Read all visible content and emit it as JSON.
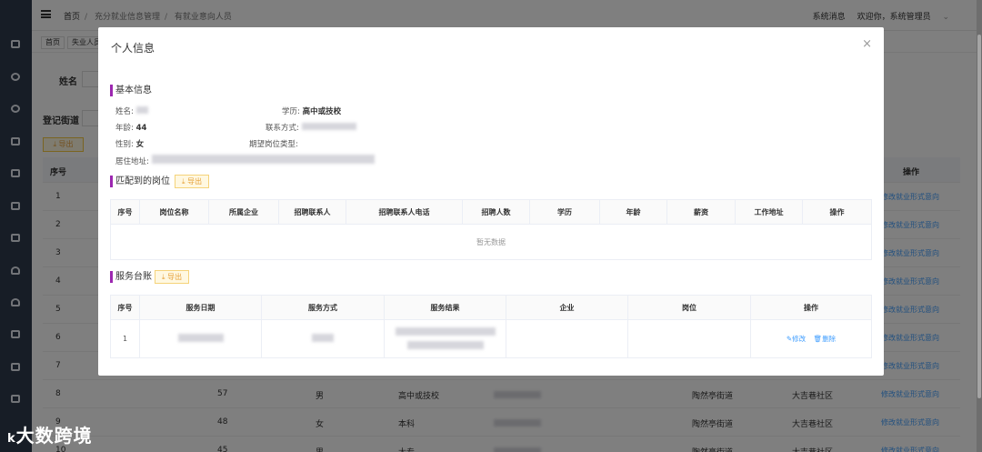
{
  "header": {
    "breadcrumbs": [
      "首页",
      "充分就业信息管理",
      "有就业意向人员"
    ],
    "notice": "系统消息",
    "user_greeting": "欢迎你，系统管理员"
  },
  "tabs": [
    "首页",
    "失业人员"
  ],
  "filters": {
    "name_label": "姓名",
    "street_label": "登记街道"
  },
  "page_export": "导出",
  "page_table": {
    "headers": [
      "序号",
      "操作"
    ],
    "rows": [
      {
        "no": "1",
        "age": "",
        "gender": "",
        "edu": "",
        "street": "",
        "community": "",
        "action": "修改就业形式意向"
      },
      {
        "no": "2",
        "age": "",
        "gender": "",
        "edu": "",
        "street": "",
        "community": "",
        "action": "修改就业形式意向"
      },
      {
        "no": "3",
        "age": "",
        "gender": "",
        "edu": "",
        "street": "",
        "community": "",
        "action": "修改就业形式意向"
      },
      {
        "no": "4",
        "age": "",
        "gender": "",
        "edu": "",
        "street": "",
        "community": "",
        "action": "修改就业形式意向"
      },
      {
        "no": "5",
        "age": "",
        "gender": "",
        "edu": "",
        "street": "",
        "community": "",
        "action": "修改就业形式意向"
      },
      {
        "no": "6",
        "age": "",
        "gender": "",
        "edu": "",
        "street": "",
        "community": "",
        "action": "修改就业形式意向"
      },
      {
        "no": "7",
        "age": "",
        "gender": "",
        "edu": "",
        "street": "",
        "community": "",
        "action": "修改就业形式意向"
      },
      {
        "no": "8",
        "age": "57",
        "gender": "男",
        "edu": "高中或技校",
        "street": "陶然亭街道",
        "community": "大吉巷社区",
        "action": "修改就业形式意向"
      },
      {
        "no": "9",
        "age": "48",
        "gender": "女",
        "edu": "本科",
        "street": "陶然亭街道",
        "community": "大吉巷社区",
        "action": "修改就业形式意向"
      },
      {
        "no": "10",
        "age": "45",
        "gender": "男",
        "edu": "大专",
        "street": "陶然亭街道",
        "community": "大吉巷社区",
        "action": "修改就业形式意向"
      }
    ]
  },
  "watermark": "大数跨境",
  "modal": {
    "title": "个人信息",
    "close": "×",
    "basic": {
      "title": "基本信息",
      "name_label": "姓名:",
      "age_label": "年龄:",
      "age": "44",
      "gender_label": "性别:",
      "gender": "女",
      "address_label": "居住地址:",
      "edu_label": "学历:",
      "edu": "高中或技校",
      "contact_label": "联系方式:",
      "job_type_label": "期望岗位类型:"
    },
    "jobs": {
      "title": "匹配到的岗位",
      "export": "导出",
      "headers": [
        "序号",
        "岗位名称",
        "所属企业",
        "招聘联系人",
        "招聘联系人电话",
        "招聘人数",
        "学历",
        "年龄",
        "薪资",
        "工作地址",
        "操作"
      ],
      "empty": "暂无数据"
    },
    "service": {
      "title": "服务台账",
      "export": "导出",
      "headers": [
        "序号",
        "服务日期",
        "服务方式",
        "服务结果",
        "企业",
        "岗位",
        "操作"
      ],
      "rows": [
        {
          "no": "1",
          "edit": "修改",
          "del": "删除"
        }
      ]
    }
  }
}
